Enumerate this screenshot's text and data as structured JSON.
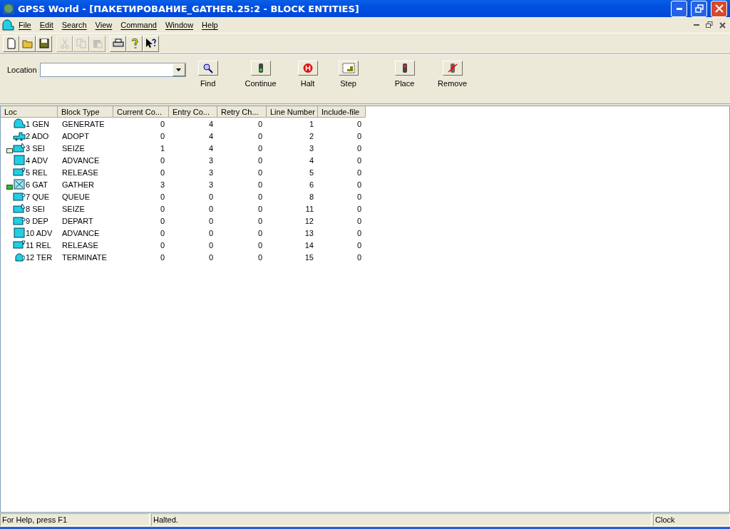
{
  "window": {
    "title": "GPSS World - [ПАКЕТИРОВАНИЕ_GATHER.25:2  -  BLOCK ENTITIES]"
  },
  "menu": [
    "File",
    "Edit",
    "Search",
    "View",
    "Command",
    "Window",
    "Help"
  ],
  "toolbar": [
    {
      "kind": "new",
      "disabled": false
    },
    {
      "kind": "open",
      "disabled": false
    },
    {
      "kind": "save",
      "disabled": false
    },
    {
      "kind": "cut",
      "disabled": true
    },
    {
      "kind": "copy",
      "disabled": true
    },
    {
      "kind": "paste",
      "disabled": true
    },
    {
      "kind": "print",
      "disabled": false
    },
    {
      "kind": "help",
      "disabled": false
    },
    {
      "kind": "context-help",
      "disabled": false
    }
  ],
  "location": {
    "label": "Location"
  },
  "commands": [
    {
      "kind": "find",
      "label": "Find"
    },
    {
      "kind": "continue",
      "label": "Continue"
    },
    {
      "kind": "halt",
      "label": "Halt"
    },
    {
      "kind": "step",
      "label": "Step"
    },
    {
      "kind": "place",
      "label": "Place"
    },
    {
      "kind": "remove",
      "label": "Remove"
    }
  ],
  "table": {
    "columns": [
      "Loc",
      "Block Type",
      "Current Co...",
      "Entry Co...",
      "Retry Ch...",
      "Line Number",
      "Include-file"
    ],
    "rows": [
      {
        "kind": "generate",
        "node": false,
        "cells": [
          "1 GEN",
          "GENERATE",
          "0",
          "4",
          "0",
          "1",
          "0"
        ]
      },
      {
        "kind": "adopt",
        "node": false,
        "cells": [
          "2 ADO",
          "ADOPT",
          "0",
          "4",
          "0",
          "2",
          "0"
        ]
      },
      {
        "kind": "seize",
        "node": true,
        "node_active": false,
        "cells": [
          "3 SEI",
          "SEIZE",
          "1",
          "4",
          "0",
          "3",
          "0"
        ]
      },
      {
        "kind": "advance",
        "node": false,
        "cells": [
          "4 ADV",
          "ADVANCE",
          "0",
          "3",
          "0",
          "4",
          "0"
        ]
      },
      {
        "kind": "release",
        "node": false,
        "cells": [
          "5 REL",
          "RELEASE",
          "0",
          "3",
          "0",
          "5",
          "0"
        ]
      },
      {
        "kind": "gather",
        "node": true,
        "node_active": true,
        "cells": [
          "6 GAT",
          "GATHER",
          "3",
          "3",
          "0",
          "6",
          "0"
        ]
      },
      {
        "kind": "queue",
        "node": false,
        "cells": [
          "7 QUE",
          "QUEUE",
          "0",
          "0",
          "0",
          "8",
          "0"
        ]
      },
      {
        "kind": "seize",
        "node": false,
        "cells": [
          "8 SEI",
          "SEIZE",
          "0",
          "0",
          "0",
          "11",
          "0"
        ]
      },
      {
        "kind": "queue",
        "node": false,
        "cells": [
          "9 DEP",
          "DEPART",
          "0",
          "0",
          "0",
          "12",
          "0"
        ]
      },
      {
        "kind": "advance",
        "node": false,
        "cells": [
          "10 ADV",
          "ADVANCE",
          "0",
          "0",
          "0",
          "13",
          "0"
        ]
      },
      {
        "kind": "release",
        "node": false,
        "cells": [
          "11 REL",
          "RELEASE",
          "0",
          "0",
          "0",
          "14",
          "0"
        ]
      },
      {
        "kind": "terminate",
        "node": false,
        "cells": [
          "12 TER",
          "TERMINATE",
          "0",
          "0",
          "0",
          "15",
          "0"
        ]
      }
    ]
  },
  "status_bar": [
    "For Help, press F1",
    "Halted.",
    "Clock"
  ]
}
